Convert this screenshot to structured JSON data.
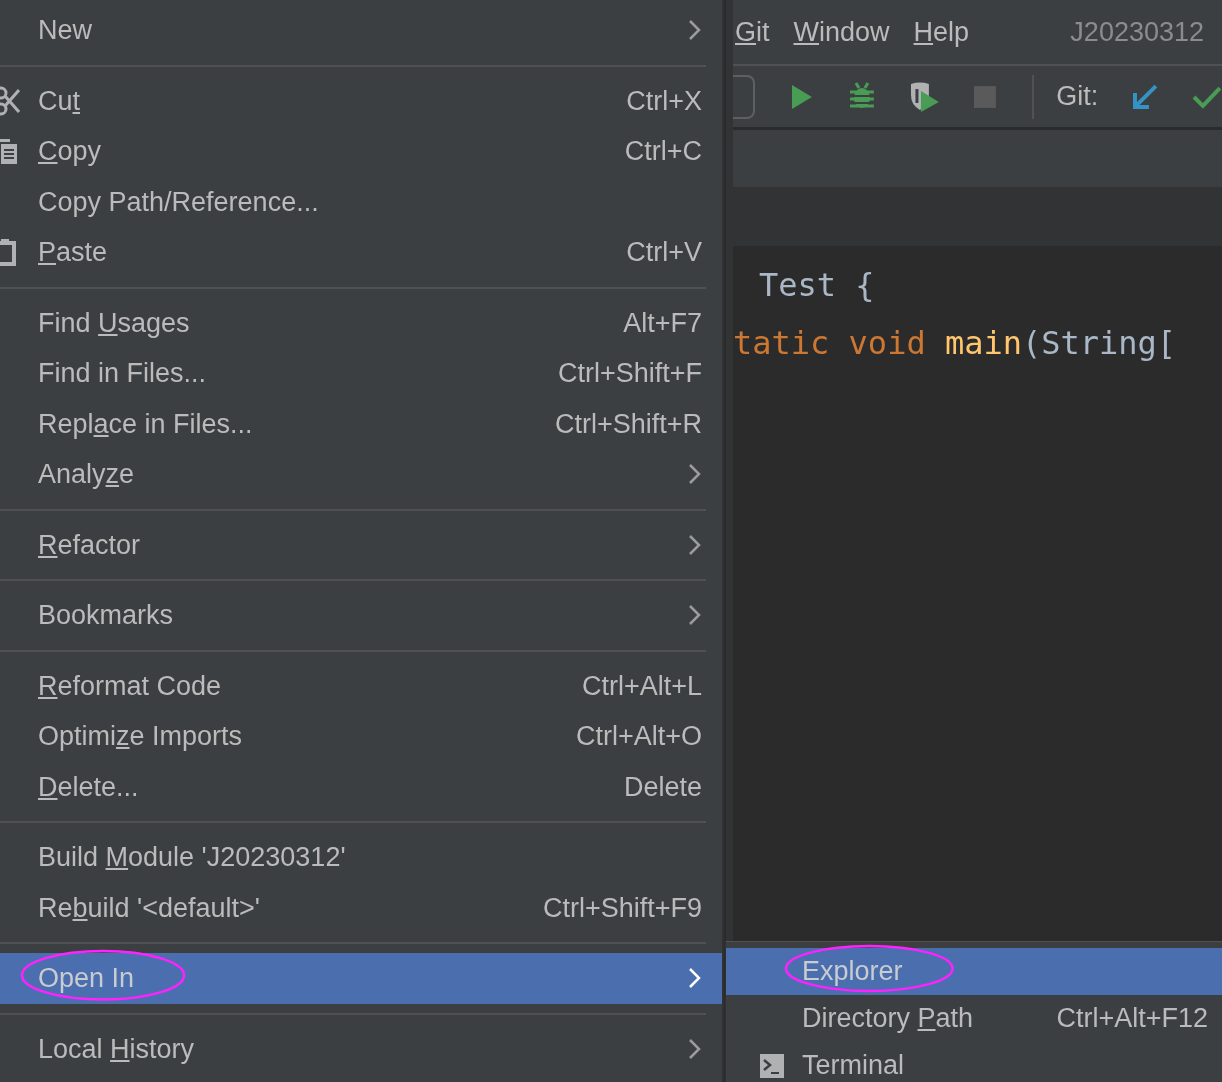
{
  "menu_bar": [
    {
      "label": {
        "key": "G",
        "post": "it"
      }
    },
    {
      "label": {
        "key": "W",
        "post": "indow"
      }
    },
    {
      "label": {
        "key": "H",
        "post": "elp"
      }
    }
  ],
  "project_name": "J20230312",
  "toolbar": {
    "git_label": "Git:"
  },
  "code_lines": [
    [
      {
        "kind": "plain",
        "text": "Test {"
      }
    ],
    [
      {
        "kind": "keyword",
        "text": "tatic void "
      },
      {
        "kind": "function",
        "text": "main"
      },
      {
        "kind": "plain",
        "text": "(String["
      }
    ]
  ],
  "context_menu": [
    {
      "kind": "item",
      "label": {
        "pre": "New"
      },
      "submenu": true,
      "selected": false,
      "circled": false
    },
    {
      "kind": "separator"
    },
    {
      "kind": "scissors_item",
      "label": {
        "pre": "Cu",
        "key": "t"
      },
      "shortcut": "Ctrl+X",
      "submenu": false,
      "selected": false,
      "circled": false
    },
    {
      "kind": "copy_item",
      "label": {
        "key": "C",
        "post": "opy"
      },
      "shortcut": "Ctrl+C",
      "submenu": false,
      "selected": false,
      "circled": false
    },
    {
      "kind": "item",
      "label": {
        "pre": "Copy Path/Reference..."
      },
      "submenu": false,
      "selected": false,
      "circled": false
    },
    {
      "kind": "paste_item",
      "label": {
        "key": "P",
        "post": "aste"
      },
      "shortcut": "Ctrl+V",
      "submenu": false,
      "selected": false,
      "circled": false
    },
    {
      "kind": "separator"
    },
    {
      "kind": "item",
      "label": {
        "pre": "Find ",
        "key": "U",
        "post": "sages"
      },
      "shortcut": "Alt+F7",
      "submenu": false,
      "selected": false,
      "circled": false
    },
    {
      "kind": "item",
      "label": {
        "pre": "Find in Files..."
      },
      "shortcut": "Ctrl+Shift+F",
      "submenu": false,
      "selected": false,
      "circled": false
    },
    {
      "kind": "item",
      "label": {
        "pre": "Repl",
        "key": "a",
        "post": "ce in Files..."
      },
      "shortcut": "Ctrl+Shift+R",
      "submenu": false,
      "selected": false,
      "circled": false
    },
    {
      "kind": "item",
      "label": {
        "pre": "Analy",
        "key": "z",
        "post": "e"
      },
      "submenu": true,
      "selected": false,
      "circled": false
    },
    {
      "kind": "separator"
    },
    {
      "kind": "item",
      "label": {
        "key": "R",
        "post": "efactor"
      },
      "submenu": true,
      "selected": false,
      "circled": false
    },
    {
      "kind": "separator"
    },
    {
      "kind": "item",
      "label": {
        "pre": "Bookmarks"
      },
      "submenu": true,
      "selected": false,
      "circled": false
    },
    {
      "kind": "separator"
    },
    {
      "kind": "item",
      "label": {
        "key": "R",
        "post": "eformat Code"
      },
      "shortcut": "Ctrl+Alt+L",
      "submenu": false,
      "selected": false,
      "circled": false
    },
    {
      "kind": "item",
      "label": {
        "pre": "Optimi",
        "key": "z",
        "post": "e Imports"
      },
      "shortcut": "Ctrl+Alt+O",
      "submenu": false,
      "selected": false,
      "circled": false
    },
    {
      "kind": "item",
      "label": {
        "key": "D",
        "post": "elete..."
      },
      "shortcut": "Delete",
      "submenu": false,
      "selected": false,
      "circled": false
    },
    {
      "kind": "separator"
    },
    {
      "kind": "item",
      "label": {
        "pre": "Build ",
        "key": "M",
        "post": "odule 'J20230312'"
      },
      "submenu": false,
      "selected": false,
      "circled": false
    },
    {
      "kind": "item",
      "label": {
        "pre": "Re",
        "key": "b",
        "post": "uild '<default>'"
      },
      "shortcut": "Ctrl+Shift+F9",
      "submenu": false,
      "selected": false,
      "circled": false
    },
    {
      "kind": "separator"
    },
    {
      "kind": "item",
      "label": {
        "pre": "Open In"
      },
      "submenu": true,
      "selected": true,
      "circled": true
    },
    {
      "kind": "separator"
    },
    {
      "kind": "item",
      "label": {
        "pre": "Local ",
        "key": "H",
        "post": "istory"
      },
      "submenu": true,
      "selected": false,
      "circled": false
    }
  ],
  "submenu": [
    {
      "kind": "item",
      "label": {
        "pre": "Explorer"
      },
      "selected": true,
      "circled": true
    },
    {
      "kind": "item",
      "label": {
        "pre": "Directory ",
        "key": "P",
        "post": "ath"
      },
      "shortcut": "Ctrl+Alt+F12",
      "selected": false,
      "circled": false
    },
    {
      "kind": "terminal_item",
      "label": {
        "pre": "Terminal"
      },
      "selected": false,
      "circled": false
    }
  ]
}
